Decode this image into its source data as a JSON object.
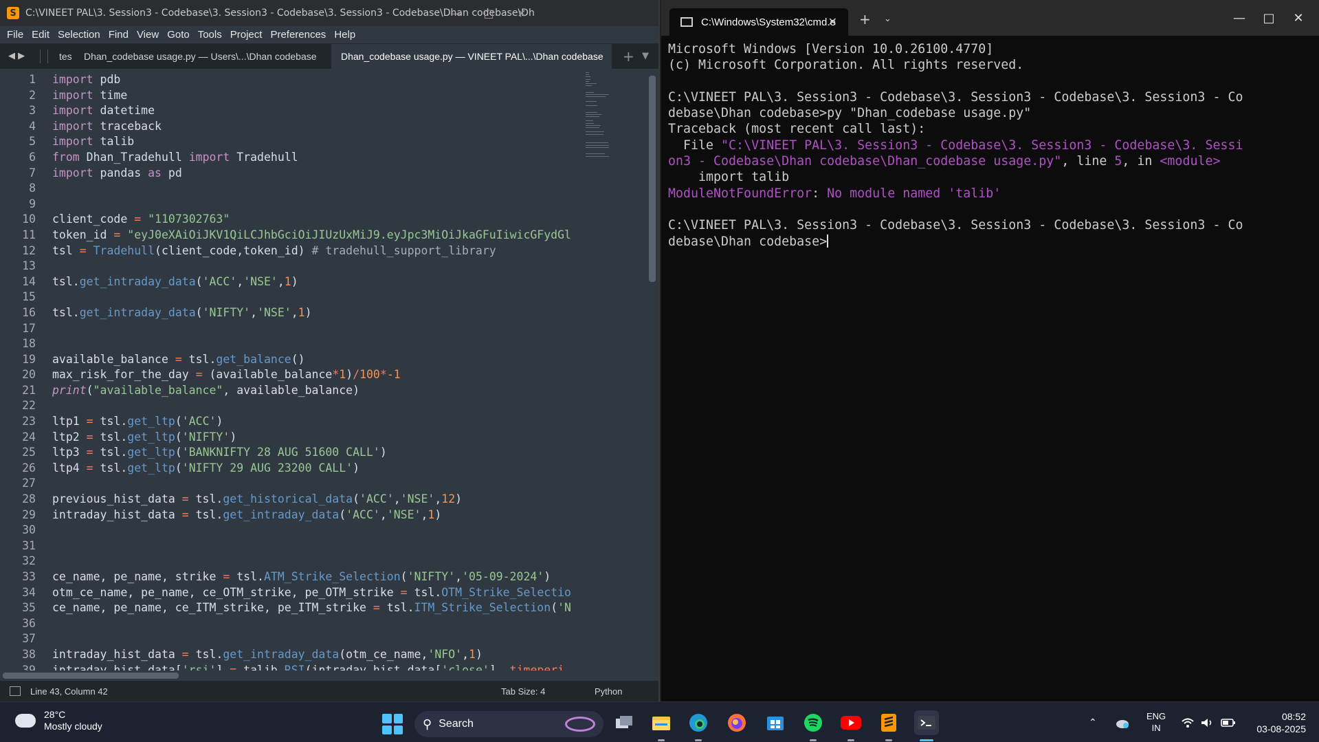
{
  "sublime": {
    "title": "C:\\VINEET PAL\\3. Session3 - Codebase\\3. Session3 - Codebase\\3. Session3 - Codebase\\Dhan codebase\\Dhan_c...",
    "menu": [
      "File",
      "Edit",
      "Selection",
      "Find",
      "View",
      "Goto",
      "Tools",
      "Project",
      "Preferences",
      "Help"
    ],
    "tabs": [
      {
        "label": "tes"
      },
      {
        "label": "Dhan_codebase usage.py — Users\\...\\Dhan codebase",
        "modified_dot_color": "#e0505a"
      },
      {
        "label": "Dhan_codebase usage.py — VINEET PAL\\...\\Dhan codebase",
        "modified_dot_color": "#9aa0a6",
        "active": true
      }
    ],
    "line_numbers": [
      "1",
      "2",
      "3",
      "4",
      "5",
      "6",
      "7",
      "8",
      "9",
      "10",
      "11",
      "12",
      "13",
      "14",
      "15",
      "16",
      "17",
      "18",
      "19",
      "20",
      "21",
      "22",
      "23",
      "24",
      "25",
      "26",
      "27",
      "28",
      "29",
      "30",
      "31",
      "32",
      "33",
      "34",
      "35",
      "36",
      "37",
      "38",
      "39"
    ],
    "status": {
      "position": "Line 43, Column 42",
      "tab_size": "Tab Size: 4",
      "syntax": "Python"
    },
    "code_lines": [
      [
        {
          "t": "import",
          "c": "kw"
        },
        {
          "t": " pdb"
        }
      ],
      [
        {
          "t": "import",
          "c": "kw"
        },
        {
          "t": " time"
        }
      ],
      [
        {
          "t": "import",
          "c": "kw"
        },
        {
          "t": " datetime"
        }
      ],
      [
        {
          "t": "import",
          "c": "kw"
        },
        {
          "t": " traceback"
        }
      ],
      [
        {
          "t": "import",
          "c": "kw"
        },
        {
          "t": " talib"
        }
      ],
      [
        {
          "t": "from",
          "c": "kw"
        },
        {
          "t": " Dhan_Tradehull "
        },
        {
          "t": "import",
          "c": "kw"
        },
        {
          "t": " Tradehull"
        }
      ],
      [
        {
          "t": "import",
          "c": "kw"
        },
        {
          "t": " pandas "
        },
        {
          "t": "as",
          "c": "kw"
        },
        {
          "t": " pd"
        }
      ],
      [],
      [],
      [
        {
          "t": "client_code "
        },
        {
          "t": "=",
          "c": "op"
        },
        {
          "t": " "
        },
        {
          "t": "\"1107302763\"",
          "c": "st"
        }
      ],
      [
        {
          "t": "token_id "
        },
        {
          "t": "=",
          "c": "op"
        },
        {
          "t": " "
        },
        {
          "t": "\"eyJ0eXAiOiJKV1QiLCJhbGciOiJIUzUxMiJ9.eyJpc3MiOiJkaGFuIiwicGFydGl",
          "c": "st"
        }
      ],
      [
        {
          "t": "tsl "
        },
        {
          "t": "=",
          "c": "op"
        },
        {
          "t": " "
        },
        {
          "t": "Tradehull",
          "c": "fn"
        },
        {
          "t": "(client_code,token_id) "
        },
        {
          "t": "# tradehull_support_library",
          "c": "cm"
        }
      ],
      [],
      [
        {
          "t": "tsl."
        },
        {
          "t": "get_intraday_data",
          "c": "fn"
        },
        {
          "t": "("
        },
        {
          "t": "'ACC'",
          "c": "st"
        },
        {
          "t": ","
        },
        {
          "t": "'NSE'",
          "c": "st"
        },
        {
          "t": ","
        },
        {
          "t": "1",
          "c": "nm"
        },
        {
          "t": ")"
        }
      ],
      [],
      [
        {
          "t": "tsl."
        },
        {
          "t": "get_intraday_data",
          "c": "fn"
        },
        {
          "t": "("
        },
        {
          "t": "'NIFTY'",
          "c": "st"
        },
        {
          "t": ","
        },
        {
          "t": "'NSE'",
          "c": "st"
        },
        {
          "t": ","
        },
        {
          "t": "1",
          "c": "nm"
        },
        {
          "t": ")"
        }
      ],
      [],
      [],
      [
        {
          "t": "available_balance "
        },
        {
          "t": "=",
          "c": "op"
        },
        {
          "t": " tsl."
        },
        {
          "t": "get_balance",
          "c": "fn"
        },
        {
          "t": "()"
        }
      ],
      [
        {
          "t": "max_risk_for_the_day "
        },
        {
          "t": "=",
          "c": "op"
        },
        {
          "t": " (available_balance"
        },
        {
          "t": "*",
          "c": "op"
        },
        {
          "t": "1",
          "c": "nm"
        },
        {
          "t": ")"
        },
        {
          "t": "/",
          "c": "op"
        },
        {
          "t": "100",
          "c": "nm"
        },
        {
          "t": "*",
          "c": "op"
        },
        {
          "t": "-1",
          "c": "nm"
        }
      ],
      [
        {
          "t": "print",
          "c": "it"
        },
        {
          "t": "("
        },
        {
          "t": "\"available_balance\"",
          "c": "st"
        },
        {
          "t": ", available_balance)"
        }
      ],
      [],
      [
        {
          "t": "ltp1 "
        },
        {
          "t": "=",
          "c": "op"
        },
        {
          "t": " tsl."
        },
        {
          "t": "get_ltp",
          "c": "fn"
        },
        {
          "t": "("
        },
        {
          "t": "'ACC'",
          "c": "st"
        },
        {
          "t": ")"
        }
      ],
      [
        {
          "t": "ltp2 "
        },
        {
          "t": "=",
          "c": "op"
        },
        {
          "t": " tsl."
        },
        {
          "t": "get_ltp",
          "c": "fn"
        },
        {
          "t": "("
        },
        {
          "t": "'NIFTY'",
          "c": "st"
        },
        {
          "t": ")"
        }
      ],
      [
        {
          "t": "ltp3 "
        },
        {
          "t": "=",
          "c": "op"
        },
        {
          "t": " tsl."
        },
        {
          "t": "get_ltp",
          "c": "fn"
        },
        {
          "t": "("
        },
        {
          "t": "'BANKNIFTY 28 AUG 51600 CALL'",
          "c": "st"
        },
        {
          "t": ")"
        }
      ],
      [
        {
          "t": "ltp4 "
        },
        {
          "t": "=",
          "c": "op"
        },
        {
          "t": " tsl."
        },
        {
          "t": "get_ltp",
          "c": "fn"
        },
        {
          "t": "("
        },
        {
          "t": "'NIFTY 29 AUG 23200 CALL'",
          "c": "st"
        },
        {
          "t": ")"
        }
      ],
      [],
      [
        {
          "t": "previous_hist_data "
        },
        {
          "t": "=",
          "c": "op"
        },
        {
          "t": " tsl."
        },
        {
          "t": "get_historical_data",
          "c": "fn"
        },
        {
          "t": "("
        },
        {
          "t": "'ACC'",
          "c": "st"
        },
        {
          "t": ","
        },
        {
          "t": "'NSE'",
          "c": "st"
        },
        {
          "t": ","
        },
        {
          "t": "12",
          "c": "nm"
        },
        {
          "t": ")"
        }
      ],
      [
        {
          "t": "intraday_hist_data "
        },
        {
          "t": "=",
          "c": "op"
        },
        {
          "t": " tsl."
        },
        {
          "t": "get_intraday_data",
          "c": "fn"
        },
        {
          "t": "("
        },
        {
          "t": "'ACC'",
          "c": "st"
        },
        {
          "t": ","
        },
        {
          "t": "'NSE'",
          "c": "st"
        },
        {
          "t": ","
        },
        {
          "t": "1",
          "c": "nm"
        },
        {
          "t": ")"
        }
      ],
      [],
      [],
      [],
      [
        {
          "t": "ce_name, pe_name, strike "
        },
        {
          "t": "=",
          "c": "op"
        },
        {
          "t": " tsl."
        },
        {
          "t": "ATM_Strike_Selection",
          "c": "fn"
        },
        {
          "t": "("
        },
        {
          "t": "'NIFTY'",
          "c": "st"
        },
        {
          "t": ","
        },
        {
          "t": "'05-09-2024'",
          "c": "st"
        },
        {
          "t": ")"
        }
      ],
      [
        {
          "t": "otm_ce_name, pe_name, ce_OTM_strike, pe_OTM_strike "
        },
        {
          "t": "=",
          "c": "op"
        },
        {
          "t": " tsl."
        },
        {
          "t": "OTM_Strike_Selectio",
          "c": "fn"
        }
      ],
      [
        {
          "t": "ce_name, pe_name, ce_ITM_strike, pe_ITM_strike "
        },
        {
          "t": "=",
          "c": "op"
        },
        {
          "t": " tsl."
        },
        {
          "t": "ITM_Strike_Selection",
          "c": "fn"
        },
        {
          "t": "("
        },
        {
          "t": "'N",
          "c": "st"
        }
      ],
      [],
      [],
      [
        {
          "t": "intraday_hist_data "
        },
        {
          "t": "=",
          "c": "op"
        },
        {
          "t": " tsl."
        },
        {
          "t": "get_intraday_data",
          "c": "fn"
        },
        {
          "t": "(otm_ce_name,"
        },
        {
          "t": "'NFO'",
          "c": "st"
        },
        {
          "t": ","
        },
        {
          "t": "1",
          "c": "nm"
        },
        {
          "t": ")"
        }
      ],
      [
        {
          "t": "intraday_hist_data["
        },
        {
          "t": "'rsi'",
          "c": "st"
        },
        {
          "t": "] "
        },
        {
          "t": "=",
          "c": "op"
        },
        {
          "t": " talib."
        },
        {
          "t": "RSI",
          "c": "fn"
        },
        {
          "t": "(intraday_hist_data["
        },
        {
          "t": "'close'",
          "c": "st"
        },
        {
          "t": "], "
        },
        {
          "t": "timeperi",
          "c": "op"
        }
      ]
    ]
  },
  "terminal": {
    "tab_title": "C:\\Windows\\System32\\cmd.e",
    "lines": [
      [
        {
          "t": "Microsoft Windows [Version 10.0.26100.4770]"
        }
      ],
      [
        {
          "t": "(c) Microsoft Corporation. All rights reserved."
        }
      ],
      [],
      [
        {
          "t": "C:\\VINEET PAL\\3. Session3 - Codebase\\3. Session3 - Codebase\\3. Session3 - Co"
        }
      ],
      [
        {
          "t": "debase\\Dhan codebase>py \"Dhan_codebase usage.py\""
        }
      ],
      [
        {
          "t": "Traceback (most recent call last):"
        }
      ],
      [
        {
          "t": "  File "
        },
        {
          "t": "\"C:\\VINEET PAL\\3. Session3 - Codebase\\3. Session3 - Codebase\\3. Sessi",
          "c": "mag"
        }
      ],
      [
        {
          "t": "on3 - Codebase\\Dhan codebase\\Dhan_codebase usage.py\"",
          "c": "mag"
        },
        {
          "t": ", line "
        },
        {
          "t": "5",
          "c": "mag"
        },
        {
          "t": ", in "
        },
        {
          "t": "<module>",
          "c": "mag"
        }
      ],
      [
        {
          "t": "    import talib"
        }
      ],
      [
        {
          "t": "ModuleNotFoundError",
          "c": "mag"
        },
        {
          "t": ": "
        },
        {
          "t": "No module named 'talib'",
          "c": "mag"
        }
      ],
      [],
      [
        {
          "t": "C:\\VINEET PAL\\3. Session3 - Codebase\\3. Session3 - Codebase\\3. Session3 - Co"
        }
      ],
      [
        {
          "t": "debase\\Dhan codebase>"
        }
      ]
    ]
  },
  "taskbar": {
    "weather_temp": "28°C",
    "weather_desc": "Mostly cloudy",
    "search_label": "Search",
    "lang_primary": "ENG",
    "lang_secondary": "IN",
    "time": "08:52",
    "date": "03-08-2025",
    "apps": [
      "task-view",
      "file-explorer",
      "edge",
      "firefox",
      "microsoft-store",
      "spotify",
      "youtube",
      "sublime-text",
      "terminal"
    ]
  },
  "colors": {
    "keyword": "#c594c5",
    "string": "#99c794",
    "number": "#f99157",
    "function": "#6699cc",
    "error_magenta": "#b14fc7",
    "accent": "#4cc2ff"
  }
}
